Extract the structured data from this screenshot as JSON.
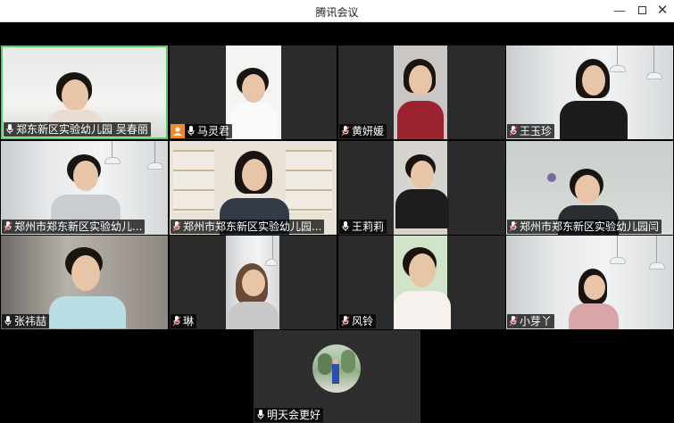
{
  "window": {
    "title": "腾讯会议",
    "minimize_symbol": "—",
    "close_symbol": "✕"
  },
  "participants": [
    {
      "name": "郑东新区实验幼儿园 吴春丽",
      "mic": "on",
      "active": true
    },
    {
      "name": "马灵君",
      "mic": "on",
      "host": true
    },
    {
      "name": "黄妍媛",
      "mic": "muted"
    },
    {
      "name": "王玉珍",
      "mic": "muted"
    },
    {
      "name": "郑州市郑东新区实验幼儿...",
      "mic": "muted"
    },
    {
      "name": "郑州市郑东新区实验幼儿园...",
      "mic": "muted"
    },
    {
      "name": "王莉莉",
      "mic": "on"
    },
    {
      "name": "郑州市郑东新区实验幼儿园闫",
      "mic": "muted"
    },
    {
      "name": "张祎喆",
      "mic": "on"
    },
    {
      "name": "琳",
      "mic": "muted"
    },
    {
      "name": "风铃",
      "mic": "muted"
    },
    {
      "name": "小芽丫",
      "mic": "muted"
    },
    {
      "name": "明天会更好",
      "mic": "on"
    }
  ],
  "colors": {
    "active_border": "#4fd06a",
    "host_badge": "#f08a24",
    "muted_mic": "#ff5a5a",
    "tile_bg": "#2b2b2b"
  }
}
